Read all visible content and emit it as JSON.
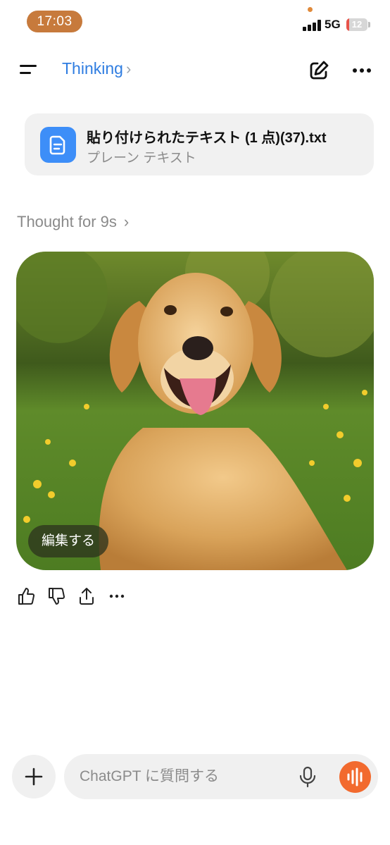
{
  "status": {
    "time": "17:03",
    "network": "5G",
    "battery": "12",
    "battery_level": 0.12
  },
  "header": {
    "model": "Thinking",
    "model_chevron": "chevron-right-icon",
    "new_chat_icon": "edit-icon",
    "more_icon": "ellipsis-icon"
  },
  "attachment": {
    "file_name": "貼り付けられたテキスト (1 点)(37).txt",
    "file_type": "プレーン テキスト",
    "icon": "document-icon"
  },
  "thought": {
    "label": "Thought for 9s"
  },
  "image": {
    "subject": "golden-retriever-icon",
    "edit_label": "編集する"
  },
  "actions": {
    "icons": [
      "thumbs-up-icon",
      "thumbs-down-icon",
      "share-icon",
      "more-icon"
    ]
  },
  "composer": {
    "placeholder": "ChatGPT に質問する",
    "accent": "#f26a2e"
  },
  "colors": {
    "link": "#2f7de1",
    "status_pill": "#c77a3c",
    "file_icon": "#3d8ef8"
  }
}
